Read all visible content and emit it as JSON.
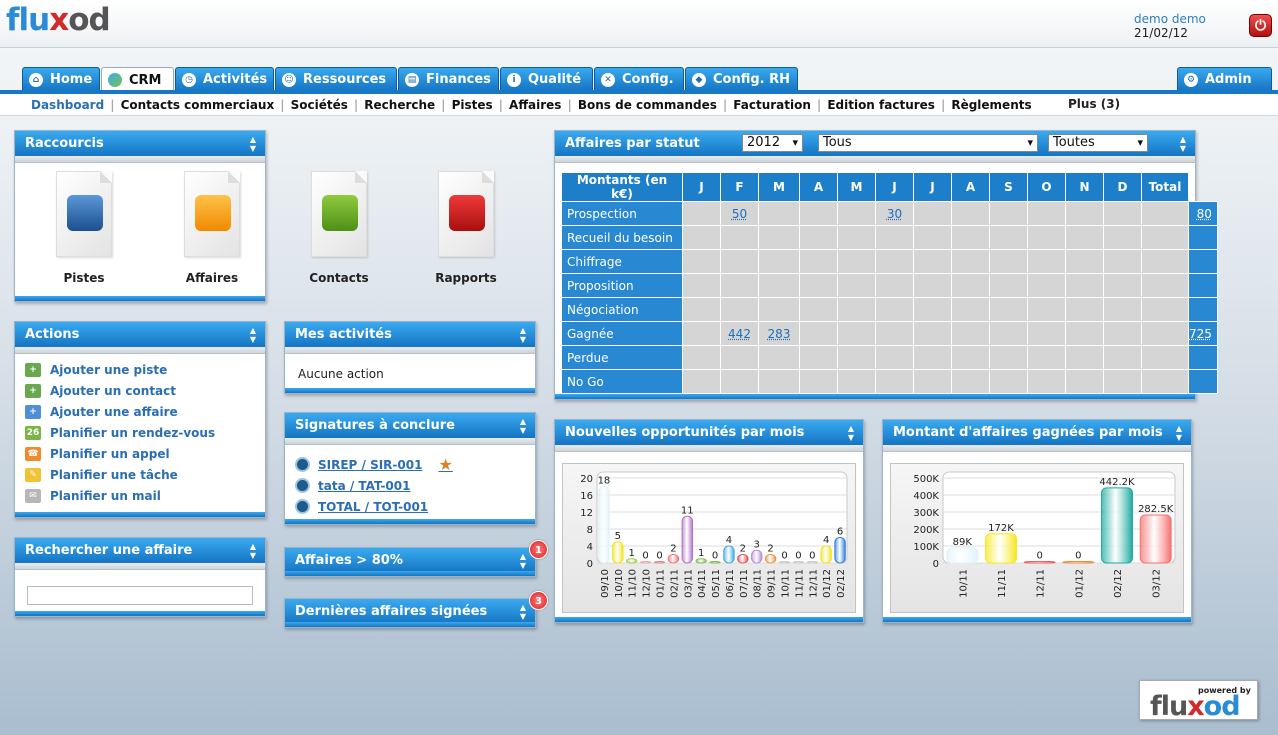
{
  "header": {
    "logo_parts": [
      "flu",
      "x",
      "od"
    ],
    "user": "demo demo",
    "date": "21/02/12",
    "logout_icon": "power-icon"
  },
  "tabs": [
    {
      "label": "Home",
      "icon": "home-icon"
    },
    {
      "label": "CRM",
      "icon": "crm-icon",
      "active": true
    },
    {
      "label": "Activités",
      "icon": "clock-icon"
    },
    {
      "label": "Ressources",
      "icon": "people-icon"
    },
    {
      "label": "Finances",
      "icon": "chart-icon"
    },
    {
      "label": "Qualité",
      "icon": "info-icon"
    },
    {
      "label": "Config.",
      "icon": "tools-icon"
    },
    {
      "label": "Config. RH",
      "icon": "hr-icon"
    }
  ],
  "admin_tab": "Admin",
  "subnav": [
    "Dashboard",
    "Contacts commerciaux",
    "Sociétés",
    "Recherche",
    "Pistes",
    "Affaires",
    "Bons de commandes",
    "Facturation",
    "Edition factures",
    "Règlements"
  ],
  "subnav_more": "Plus (3)",
  "raccourcis": {
    "title": "Raccourcis",
    "items": [
      "Pistes",
      "Affaires",
      "Contacts",
      "Rapports"
    ]
  },
  "actions": {
    "title": "Actions",
    "items": [
      "Ajouter une piste",
      "Ajouter un contact",
      "Ajouter une affaire",
      "Planifier un rendez-vous",
      "Planifier un appel",
      "Planifier une tâche",
      "Planifier un mail"
    ]
  },
  "mes_activites": {
    "title": "Mes activités",
    "empty": "Aucune action"
  },
  "signatures": {
    "title": "Signatures à conclure",
    "items": [
      "SIREP / SIR-001",
      "tata / TAT-001",
      "TOTAL / TOT-001"
    ]
  },
  "affaires80": {
    "title": "Affaires > 80%",
    "badge": "1"
  },
  "dernieres": {
    "title": "Dernières affaires signées",
    "badge": "3"
  },
  "recherche": {
    "title": "Rechercher une affaire",
    "placeholder": ""
  },
  "statut": {
    "title": "Affaires par statut",
    "filters": {
      "year": "2012",
      "type": "Tous",
      "other": "Toutes"
    },
    "header": [
      "Montants (en k€)",
      "J",
      "F",
      "M",
      "A",
      "M",
      "J",
      "J",
      "A",
      "S",
      "O",
      "N",
      "D",
      "Total"
    ],
    "rows": [
      {
        "label": "Prospection",
        "values": [
          "",
          "50",
          "",
          "",
          "",
          "30",
          "",
          "",
          "",
          "",
          "",
          "",
          ""
        ],
        "total": "80"
      },
      {
        "label": "Recueil du besoin",
        "values": [
          "",
          "",
          "",
          "",
          "",
          "",
          "",
          "",
          "",
          "",
          "",
          "",
          ""
        ],
        "total": ""
      },
      {
        "label": "Chiffrage",
        "values": [
          "",
          "",
          "",
          "",
          "",
          "",
          "",
          "",
          "",
          "",
          "",
          "",
          ""
        ],
        "total": ""
      },
      {
        "label": "Proposition",
        "values": [
          "",
          "",
          "",
          "",
          "",
          "",
          "",
          "",
          "",
          "",
          "",
          "",
          ""
        ],
        "total": ""
      },
      {
        "label": "Négociation",
        "values": [
          "",
          "",
          "",
          "",
          "",
          "",
          "",
          "",
          "",
          "",
          "",
          "",
          ""
        ],
        "total": ""
      },
      {
        "label": "Gagnée",
        "values": [
          "",
          "442",
          "283",
          "",
          "",
          "",
          "",
          "",
          "",
          "",
          "",
          "",
          ""
        ],
        "total": "725"
      },
      {
        "label": "Perdue",
        "values": [
          "",
          "",
          "",
          "",
          "",
          "",
          "",
          "",
          "",
          "",
          "",
          "",
          ""
        ],
        "total": ""
      },
      {
        "label": "No Go",
        "values": [
          "",
          "",
          "",
          "",
          "",
          "",
          "",
          "",
          "",
          "",
          "",
          "",
          ""
        ],
        "total": ""
      }
    ]
  },
  "chart_data": [
    {
      "type": "bar",
      "title": "Nouvelles opportunités par mois",
      "categories": [
        "09/10",
        "10/10",
        "11/10",
        "12/10",
        "01/11",
        "02/11",
        "03/11",
        "04/11",
        "05/11",
        "06/11",
        "07/11",
        "08/11",
        "09/11",
        "10/11",
        "11/11",
        "12/11",
        "01/12",
        "02/12"
      ],
      "values": [
        18,
        5,
        1,
        0,
        0,
        2,
        11,
        1,
        0,
        4,
        2,
        3,
        2,
        0,
        0,
        0,
        4,
        6
      ],
      "labels": [
        "18",
        "5",
        "1",
        "0",
        "0",
        "2",
        "11",
        "1",
        "0",
        "4",
        "2",
        "3",
        "2",
        "0",
        "0",
        "0",
        "4",
        "6"
      ],
      "yticks": [
        "0",
        "4",
        "8",
        "12",
        "16",
        "20"
      ],
      "ylim": [
        0,
        20
      ],
      "grid": true,
      "colors": [
        "#dff2fb",
        "#f2e21b",
        "#a5d04c",
        "#f7a3a3",
        "#f08080",
        "#f56d6d",
        "#b372c9",
        "#7fbf4d",
        "#7fbf4d",
        "#3ca8e8",
        "#e64848",
        "#b88ad6",
        "#f28c3b",
        "#c9c9c9",
        "#c9c9c9",
        "#c9c9c9",
        "#f2e21b",
        "#2f7fd9"
      ]
    },
    {
      "type": "bar",
      "title": "Montant d'affaires gagnées par mois",
      "categories": [
        "10/11",
        "11/11",
        "12/11",
        "01/12",
        "02/12",
        "03/12"
      ],
      "values": [
        89,
        172,
        0,
        0,
        442.2,
        282.5
      ],
      "labels": [
        "89K",
        "172K",
        "0",
        "0",
        "442.2K",
        "282.5K"
      ],
      "yticks": [
        "0",
        "100K",
        "200K",
        "300K",
        "400K",
        "500K"
      ],
      "ylim": [
        0,
        500
      ],
      "grid": true,
      "colors": [
        "#dff2fb",
        "#f7e81e",
        "#f06060",
        "#f28c3b",
        "#1eaaa0",
        "#f77070"
      ]
    }
  ],
  "powered": {
    "tag": "powered by",
    "logo": "fluxod"
  },
  "colors": {
    "accent": "#1574c3",
    "badge": "#d72121"
  }
}
